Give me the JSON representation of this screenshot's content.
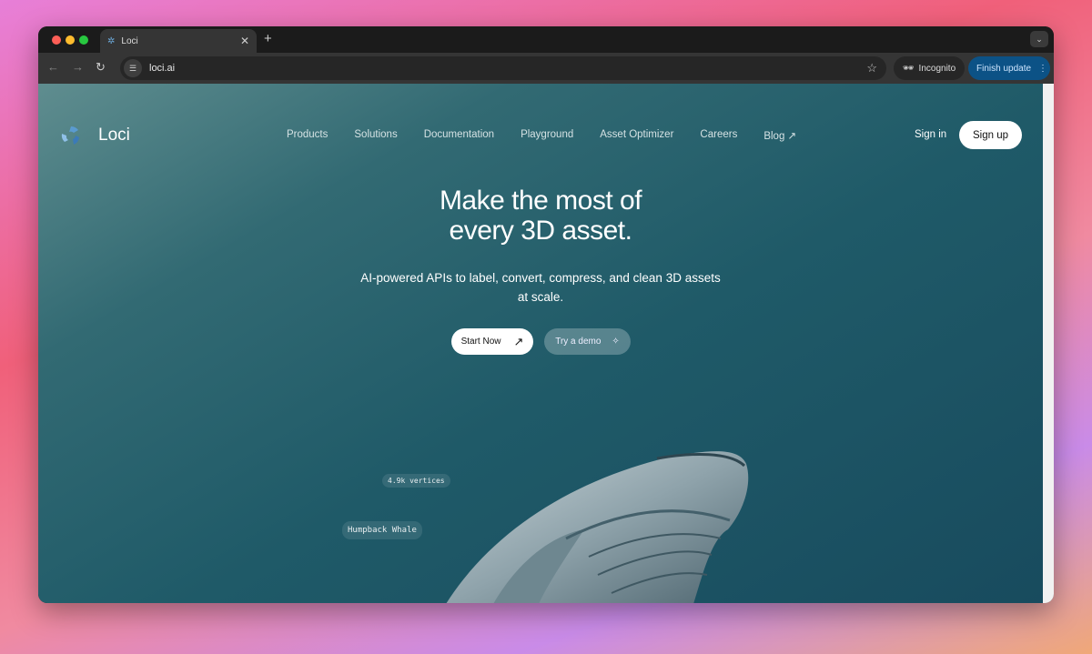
{
  "browser": {
    "tab_title": "Loci",
    "url": "loci.ai",
    "incognito_label": "Incognito",
    "finish_update_label": "Finish update"
  },
  "site": {
    "brand": "Loci",
    "nav": [
      "Products",
      "Solutions",
      "Documentation",
      "Playground",
      "Asset Optimizer",
      "Careers",
      "Blog ↗"
    ],
    "sign_in": "Sign in",
    "sign_up": "Sign up",
    "hero_line1": "Make the most of",
    "hero_line2": "every 3D asset.",
    "subtitle": "AI-powered APIs to label, convert, compress, and clean 3D assets at scale.",
    "start_now": "Start Now",
    "try_demo": "Try a demo",
    "vertices_tag": "4.9k vertices",
    "model_tag": "Humpback Whale"
  }
}
